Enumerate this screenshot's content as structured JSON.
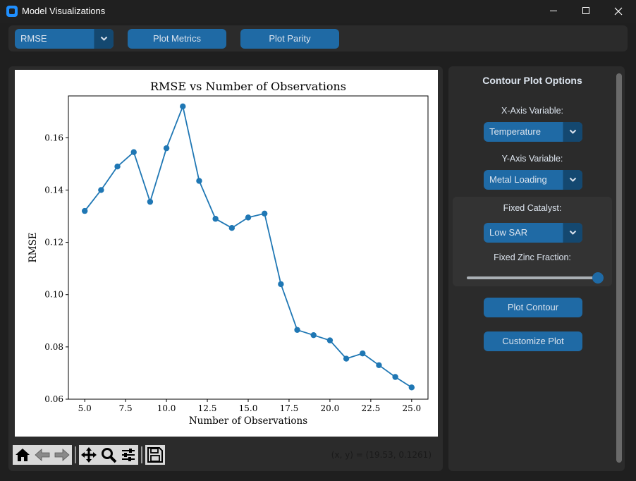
{
  "window": {
    "title": "Model Visualizations"
  },
  "topbar": {
    "metric_select": "RMSE",
    "plot_metrics_label": "Plot Metrics",
    "plot_parity_label": "Plot Parity"
  },
  "chart_data": {
    "type": "line",
    "title": "RMSE vs Number of Observations",
    "xlabel": "Number of Observations",
    "ylabel": "RMSE",
    "xlim": [
      4.0,
      26.0
    ],
    "ylim": [
      0.06,
      0.176
    ],
    "xticks": [
      "5.0",
      "7.5",
      "10.0",
      "12.5",
      "15.0",
      "17.5",
      "20.0",
      "22.5",
      "25.0"
    ],
    "yticks": [
      "0.06",
      "0.08",
      "0.10",
      "0.12",
      "0.14",
      "0.16"
    ],
    "color": "#1f77b4",
    "x": [
      5,
      6,
      7,
      8,
      9,
      10,
      11,
      12,
      13,
      14,
      15,
      16,
      17,
      18,
      19,
      20,
      21,
      22,
      23,
      24,
      25
    ],
    "y": [
      0.132,
      0.14,
      0.149,
      0.1545,
      0.1355,
      0.156,
      0.172,
      0.1435,
      0.129,
      0.1255,
      0.1295,
      0.131,
      0.104,
      0.0865,
      0.0845,
      0.0825,
      0.0755,
      0.0775,
      0.073,
      0.0685,
      0.0645
    ]
  },
  "toolbar": {
    "icons": [
      "home-icon",
      "back-icon",
      "forward-icon",
      "pan-icon",
      "zoom-icon",
      "configure-subplots-icon",
      "save-icon"
    ],
    "coordinates": "(x, y) = (19.53, 0.1261)"
  },
  "side_panel": {
    "title": "Contour Plot Options",
    "x_axis_label": "X-Axis Variable:",
    "x_axis_value": "Temperature",
    "y_axis_label": "Y-Axis Variable:",
    "y_axis_value": "Metal Loading",
    "catalyst_label": "Fixed Catalyst:",
    "catalyst_value": "Low SAR",
    "zinc_label": "Fixed Zinc Fraction:",
    "zinc_value": 1.0,
    "plot_contour_label": "Plot Contour",
    "customize_label": "Customize Plot"
  },
  "colors": {
    "accent": "#1f6aa5",
    "accent_dark": "#144870",
    "panel": "#2b2b2b",
    "background": "#1f1f1f"
  }
}
